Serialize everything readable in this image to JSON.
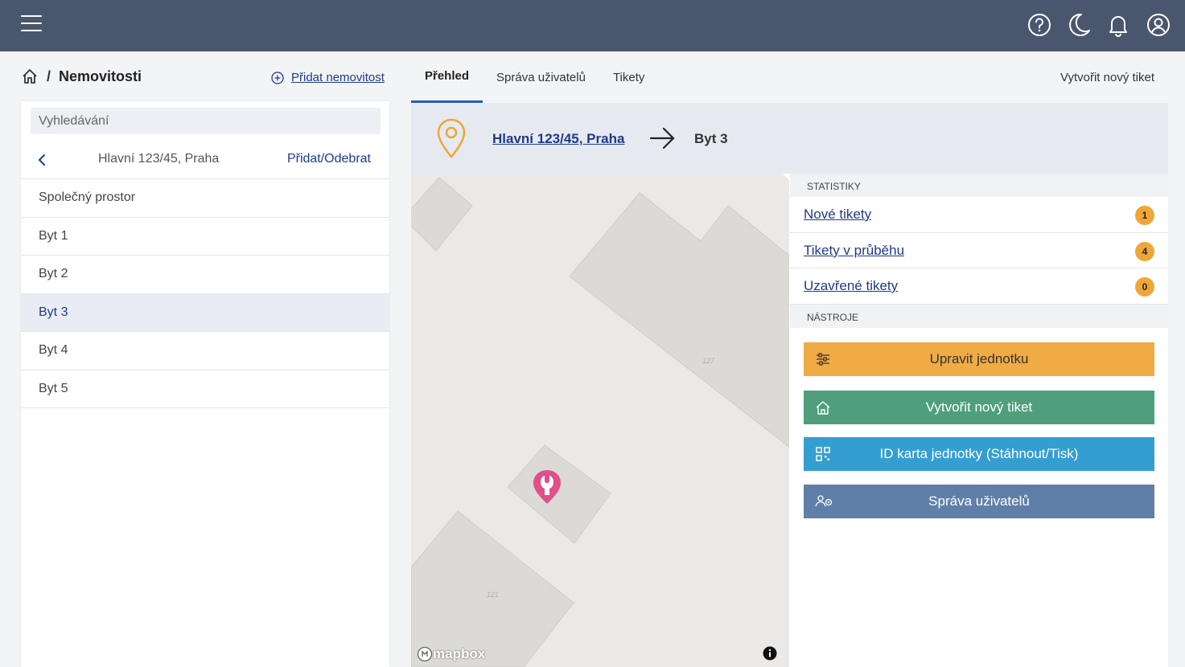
{
  "topbar": {
    "icons": [
      "menu-icon",
      "help-icon",
      "moon-icon",
      "bell-icon",
      "user-icon"
    ],
    "bg_color": "#4a566d"
  },
  "breadcrumb": {
    "separator": "/",
    "title": "Nemovitosti"
  },
  "add_property_label": "Přidat nemovitost",
  "tabs": [
    {
      "label": "Přehled",
      "active": true
    },
    {
      "label": "Správa uživatelů",
      "active": false
    },
    {
      "label": "Tikety",
      "active": false
    }
  ],
  "create_ticket_top_label": "Vytvořit nový tiket",
  "sidebar": {
    "search_placeholder": "Vyhledávání",
    "current_address": "Hlavní 123/45, Praha",
    "add_remove_label": "Přidat/Odebrat",
    "units": [
      {
        "label": "Společný prostor",
        "selected": false
      },
      {
        "label": "Byt 1",
        "selected": false
      },
      {
        "label": "Byt 2",
        "selected": false
      },
      {
        "label": "Byt 3",
        "selected": true
      },
      {
        "label": "Byt 4",
        "selected": false
      },
      {
        "label": "Byt 5",
        "selected": false
      }
    ]
  },
  "header": {
    "address_link": "Hlavní 123/45, Praha",
    "unit": "Byt 3"
  },
  "map": {
    "attribution": "mapbox",
    "building_numbers": [
      "127",
      "121"
    ]
  },
  "stats": {
    "section_label": "STATISTIKY",
    "rows": [
      {
        "label": "Nové tikety",
        "count": "1"
      },
      {
        "label": "Tikety v průběhu",
        "count": "4"
      },
      {
        "label": "Uzavřené tikety",
        "count": "0"
      }
    ]
  },
  "tools": {
    "section_label": "NÁSTROJE",
    "buttons": [
      {
        "label": "Upravit jednotku",
        "color": "#f0ab44",
        "text_color": "#333333",
        "icon": "sliders-icon"
      },
      {
        "label": "Vytvořit nový tiket",
        "color": "#4f9f7c",
        "text_color": "#ffffff",
        "icon": "house-icon"
      },
      {
        "label": "ID karta jednotky (Stáhnout/Tisk)",
        "color": "#359ed1",
        "text_color": "#ffffff",
        "icon": "qr-code-icon"
      },
      {
        "label": "Správa uživatelů",
        "color": "#5f7fa8",
        "text_color": "#ffffff",
        "icon": "users-cog-icon"
      }
    ]
  },
  "colors": {
    "accent": "#1f3a8a",
    "badge": "#f0a637",
    "pin": "#f0a637",
    "marker": "#e0508a"
  }
}
